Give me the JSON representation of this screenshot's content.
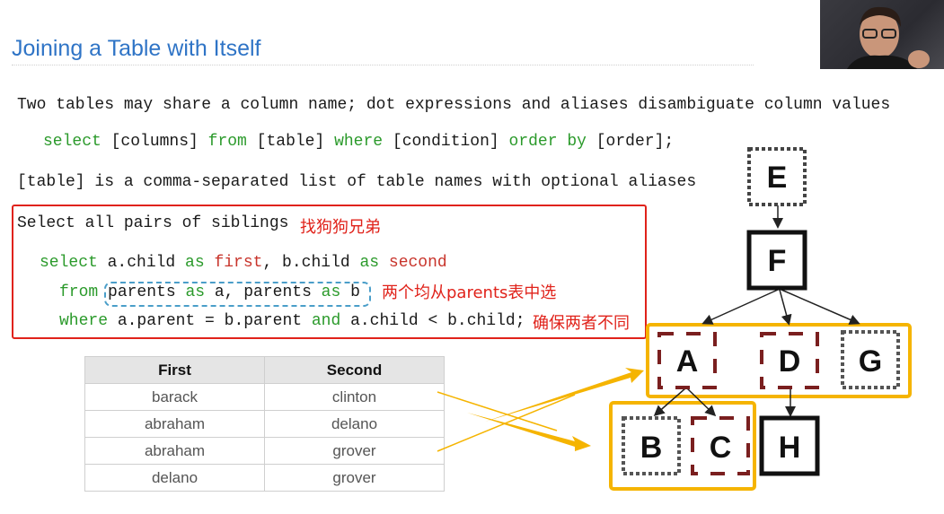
{
  "title": "Joining a Table with Itself",
  "lines": {
    "intro": "Two tables may share a column name; dot expressions and aliases disambiguate column values",
    "syntax": {
      "select": "select",
      "columns": " [columns] ",
      "from": "from",
      "table": " [table] ",
      "where": "where",
      "condition": " [condition] ",
      "order_by": "order by",
      "order": " [order];"
    },
    "table_desc": "[table] is a comma-separated list of table names with optional aliases"
  },
  "example": {
    "heading": "Select all pairs of siblings",
    "heading_note": "找狗狗兄弟",
    "line1": {
      "select": "select",
      "a_child": " a.child ",
      "as1": "as",
      "first": " first",
      "comma_b_child": ", b.child ",
      "as2": "as",
      "second": " second"
    },
    "line2": {
      "from": "from",
      "parents_a": " parents ",
      "as1": "as",
      "a_comma": " a, parents ",
      "as2": "as",
      "b": " b",
      "note": "两个均从parents表中选"
    },
    "line3": {
      "where": "where",
      "cond1": " a.parent = b.parent ",
      "and": "and",
      "cond2": " a.child < b.child;",
      "note": "确保两者不同"
    }
  },
  "result_table": {
    "headers": [
      "First",
      "Second"
    ],
    "rows": [
      [
        "barack",
        "clinton"
      ],
      [
        "abraham",
        "delano"
      ],
      [
        "abraham",
        "grover"
      ],
      [
        "delano",
        "grover"
      ]
    ]
  },
  "diagram_nodes": {
    "E": "E",
    "F": "F",
    "A": "A",
    "D": "D",
    "G": "G",
    "B": "B",
    "C": "C",
    "H": "H"
  },
  "colors": {
    "title": "#2f74c6",
    "keyword": "#2b9a2b",
    "keyword_red": "#c8342b",
    "annotation": "#e0221a",
    "highlight": "#f5b400",
    "dashed_blue": "#4a9ec9",
    "maroon": "#7a1f1f"
  }
}
